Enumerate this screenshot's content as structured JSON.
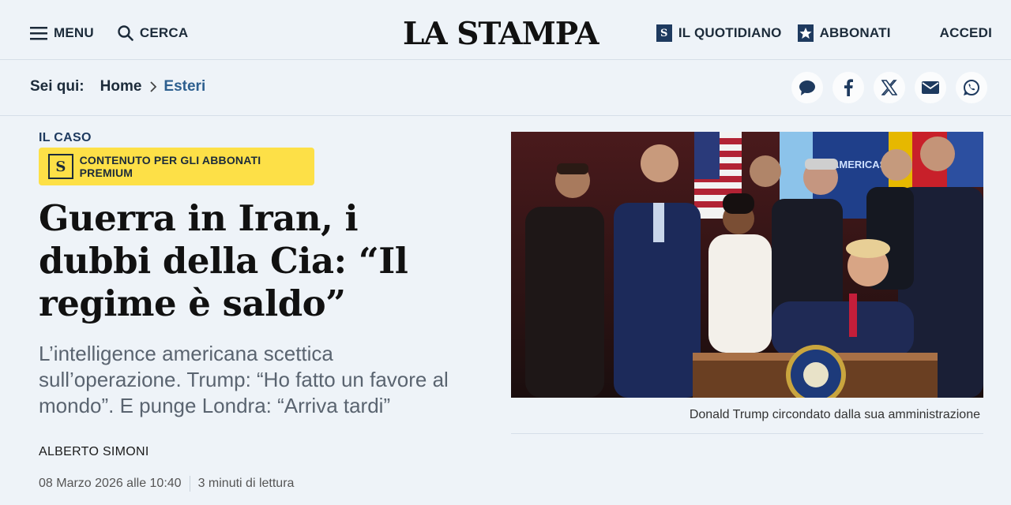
{
  "header": {
    "menu_label": "MENU",
    "search_label": "CERCA",
    "logo": "LA STAMPA",
    "quotidiano_label": "IL QUOTIDIANO",
    "abbonati_label": "ABBONATI",
    "accedi_label": "ACCEDI",
    "quotidiano_icon_letter": "S"
  },
  "breadcrumb": {
    "label": "Sei qui:",
    "items": [
      "Home",
      "Esteri"
    ]
  },
  "share": {
    "icons": [
      "comment-icon",
      "facebook-icon",
      "x-icon",
      "mail-icon",
      "whatsapp-icon"
    ]
  },
  "article": {
    "kicker": "IL CASO",
    "premium_letter": "S",
    "premium_label": "CONTENUTO PER GLI ABBONATI PREMIUM",
    "headline": "Guerra in Iran, i dubbi della Cia: “Il regime è saldo”",
    "dek": "L’intelligence americana scettica sull’operazione. Trump: “Ho fatto un favore al mondo”. E punge Londra: “Arriva tardi”",
    "author": "ALBERTO SIMONI",
    "date": "08 Marzo 2026 alle 10:40",
    "read_time": "3 minuti di lettura",
    "photo_caption": "Donald Trump circondato dalla sua amministrazione",
    "photo_banner_text": "AMERICAS"
  },
  "colors": {
    "background": "#eef3f8",
    "brand_navy": "#1e3a5f",
    "premium_yellow": "#fde047",
    "link_blue": "#2d5f8f"
  }
}
